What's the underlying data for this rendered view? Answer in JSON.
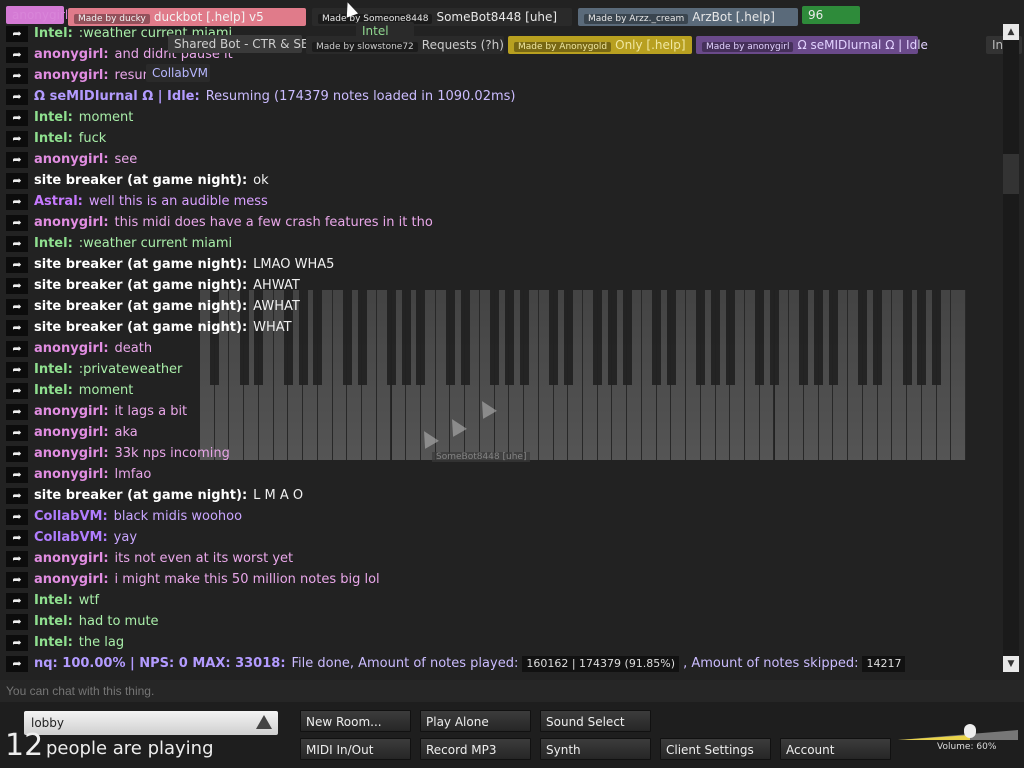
{
  "top_tags": [
    {
      "id": "tag-anonygirl",
      "text": "anonygirl",
      "color": "#d985d9",
      "bg": "#d47ad4"
    },
    {
      "id": "tag-duckbot",
      "badge": "Made by ducky",
      "text": "duckbot [.help] v5",
      "bg": "#e07b8a",
      "color": "#f3f3f3"
    },
    {
      "id": "tag-somebot",
      "badge": "Made by Someone8448",
      "text": "SomeBot8448 [uhe]",
      "bg": "#2a2a2a",
      "color": "#e8e8e8"
    },
    {
      "id": "tag-arzbot",
      "badge": "Made by Arzz._cream",
      "text": "ArzBot [.help]",
      "bg": "#5a6a7a",
      "color": "#e8e8e8"
    },
    {
      "id": "tag-96",
      "text": "96",
      "bg": "#2e8b3a",
      "color": "#eaeaea"
    },
    {
      "id": "tag-sharedbot",
      "text": "Shared Bot - CTR & SB",
      "bg": "#3a3a3a",
      "color": "#cfcfcf"
    },
    {
      "id": "tag-requests",
      "badge": "Made by slowstone72",
      "text": "Requests (?h)",
      "bg": "#2a2a2a",
      "color": "#ccc"
    },
    {
      "id": "tag-only",
      "badge": "Made by Anonygold",
      "text": "Only [.help]",
      "bg": "#b8a020",
      "color": "#f0e7a0"
    },
    {
      "id": "tag-semidiurnal",
      "badge": "Made by anonygirl",
      "text": "Ω seMIDIurnal Ω | Idle",
      "bg": "#6a4a8a",
      "color": "#e2d2ff"
    },
    {
      "id": "tag-info",
      "text": "Inf",
      "bg": "#333",
      "color": "#bbb"
    },
    {
      "id": "tag-collabvm",
      "text": "CollabVM",
      "bg": "#2a2a2a",
      "color": "#b7b7ff"
    },
    {
      "id": "tag-intel",
      "text": "Intel",
      "bg": "#2a2a2a",
      "color": "#8fd68f"
    }
  ],
  "chat": [
    {
      "name": "Intel:",
      "text": ":weather current miami",
      "name_color": "#8fe08f",
      "text_color": "#a9eea9"
    },
    {
      "name": "anonygirl:",
      "text": "and didnt pause it",
      "name_color": "#e18de1",
      "text_color": "#e9a7e9"
    },
    {
      "name": "anonygirl:",
      "text": "resume",
      "name_color": "#e18de1",
      "text_color": "#e9a7e9"
    },
    {
      "name": "Ω seMIDIurnal Ω | Idle:",
      "text": "Resuming (174379 notes loaded in 1090.02ms)",
      "name_color": "#b39bff",
      "text_color": "#cbbcff"
    },
    {
      "name": "Intel:",
      "text": "moment",
      "name_color": "#8fe08f",
      "text_color": "#a9eea9"
    },
    {
      "name": "Intel:",
      "text": "fuck",
      "name_color": "#8fe08f",
      "text_color": "#a9eea9"
    },
    {
      "name": "anonygirl:",
      "text": "see",
      "name_color": "#e18de1",
      "text_color": "#e9a7e9"
    },
    {
      "name": "site breaker (at game night):",
      "text": "ok",
      "name_color": "#ffffff",
      "text_color": "#f0f0f0"
    },
    {
      "name": "Astral:",
      "text": "well this is an audible mess",
      "name_color": "#c679ff",
      "text_color": "#d9a0ff"
    },
    {
      "name": "anonygirl:",
      "text": "this midi does have a few crash features in it tho",
      "name_color": "#e18de1",
      "text_color": "#e9a7e9"
    },
    {
      "name": "Intel:",
      "text": ":weather current miami",
      "name_color": "#8fe08f",
      "text_color": "#a9eea9"
    },
    {
      "name": "site breaker (at game night):",
      "text": "LMAO WHA5",
      "name_color": "#ffffff",
      "text_color": "#f0f0f0"
    },
    {
      "name": "site breaker (at game night):",
      "text": "AHWAT",
      "name_color": "#ffffff",
      "text_color": "#f0f0f0"
    },
    {
      "name": "site breaker (at game night):",
      "text": "AWHAT",
      "name_color": "#ffffff",
      "text_color": "#f0f0f0"
    },
    {
      "name": "site breaker (at game night):",
      "text": "WHAT",
      "name_color": "#ffffff",
      "text_color": "#f0f0f0"
    },
    {
      "name": "anonygirl:",
      "text": "death",
      "name_color": "#e18de1",
      "text_color": "#e9a7e9"
    },
    {
      "name": "Intel:",
      "text": ":privateweather",
      "name_color": "#8fe08f",
      "text_color": "#a9eea9"
    },
    {
      "name": "Intel:",
      "text": "moment",
      "name_color": "#8fe08f",
      "text_color": "#a9eea9"
    },
    {
      "name": "anonygirl:",
      "text": "it lags a bit",
      "name_color": "#e18de1",
      "text_color": "#e9a7e9"
    },
    {
      "name": "anonygirl:",
      "text": "aka",
      "name_color": "#e18de1",
      "text_color": "#e9a7e9"
    },
    {
      "name": "anonygirl:",
      "text": "33k nps incoming",
      "name_color": "#e18de1",
      "text_color": "#e9a7e9"
    },
    {
      "name": "anonygirl:",
      "text": "lmfao",
      "name_color": "#e18de1",
      "text_color": "#e9a7e9"
    },
    {
      "name": "site breaker (at game night):",
      "text": "L M A O",
      "name_color": "#ffffff",
      "text_color": "#f0f0f0"
    },
    {
      "name": "CollabVM:",
      "text": "black midis woohoo",
      "name_color": "#b17dff",
      "text_color": "#c9a6ff"
    },
    {
      "name": "CollabVM:",
      "text": "yay",
      "name_color": "#b17dff",
      "text_color": "#c9a6ff"
    },
    {
      "name": "anonygirl:",
      "text": "its not even at its worst yet",
      "name_color": "#e18de1",
      "text_color": "#e9a7e9"
    },
    {
      "name": "anonygirl:",
      "text": "i might make this 50 million notes big lol",
      "name_color": "#e18de1",
      "text_color": "#e9a7e9"
    },
    {
      "name": "Intel:",
      "text": "wtf",
      "name_color": "#8fe08f",
      "text_color": "#a9eea9"
    },
    {
      "name": "Intel:",
      "text": "had to mute",
      "name_color": "#8fe08f",
      "text_color": "#a9eea9"
    },
    {
      "name": "Intel:",
      "text": "the lag",
      "name_color": "#8fe08f",
      "text_color": "#a9eea9"
    }
  ],
  "last_message": {
    "name": "nq: 100.00% | NPS: 0 MAX: 33018:",
    "part1": "File done, Amount of notes played:",
    "chip1": "160162 | 174379 (91.85%)",
    "part2": ", Amount of notes skipped:",
    "chip2": "14217",
    "name_color": "#b39bff",
    "text_color": "#cbbcff"
  },
  "piano_cursor_label": "SomeBot8448 [uhe]",
  "chat_input_placeholder": "You can chat with this thing.",
  "room": {
    "name": "lobby"
  },
  "players": {
    "count": "12",
    "label": "people are playing"
  },
  "buttons": {
    "new_room": "New Room...",
    "play_alone": "Play Alone",
    "sound_select": "Sound Select",
    "midi": "MIDI In/Out",
    "record": "Record MP3",
    "synth": "Synth",
    "client_settings": "Client Settings",
    "account": "Account"
  },
  "volume": {
    "label": "Volume: 60%",
    "level": 0.6
  }
}
